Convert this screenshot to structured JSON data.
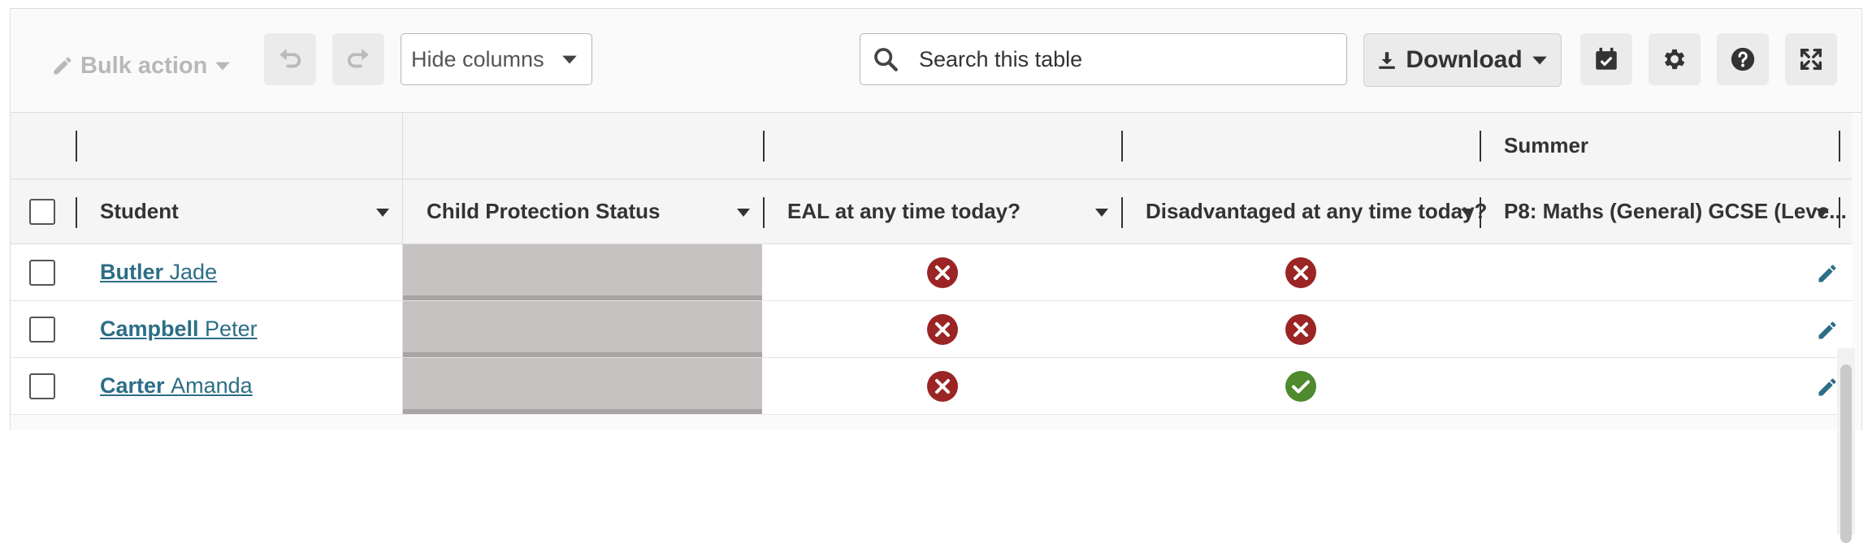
{
  "toolbar": {
    "bulk_action_label": "Bulk action",
    "hide_columns_label": "Hide columns",
    "search_placeholder": "Search this table",
    "download_label": "Download"
  },
  "table": {
    "group_headers": [
      "",
      "",
      "",
      "",
      "Summer"
    ],
    "columns": [
      "Student",
      "Child Protection Status",
      "EAL at any time today?",
      "Disadvantaged at any time today?",
      "P8: Maths (General) GCSE (Leve..."
    ],
    "rows": [
      {
        "surname": "Butler",
        "forename": "Jade",
        "eal": "no",
        "disadvantaged": "no"
      },
      {
        "surname": "Campbell",
        "forename": "Peter",
        "eal": "no",
        "disadvantaged": "no"
      },
      {
        "surname": "Carter",
        "forename": "Amanda",
        "eal": "no",
        "disadvantaged": "yes"
      }
    ]
  },
  "colors": {
    "no": "#9b2424",
    "yes": "#4f8a2e",
    "link": "#2c6e86",
    "edit": "#2c6e86"
  },
  "icons": {
    "bulk": "pencil-icon",
    "undo": "undo-icon",
    "redo": "redo-icon",
    "search": "search-icon",
    "download": "download-icon",
    "checklist": "calendar-check-icon",
    "settings": "gear-icon",
    "help": "question-circle-icon",
    "fullscreen": "expand-icon"
  }
}
